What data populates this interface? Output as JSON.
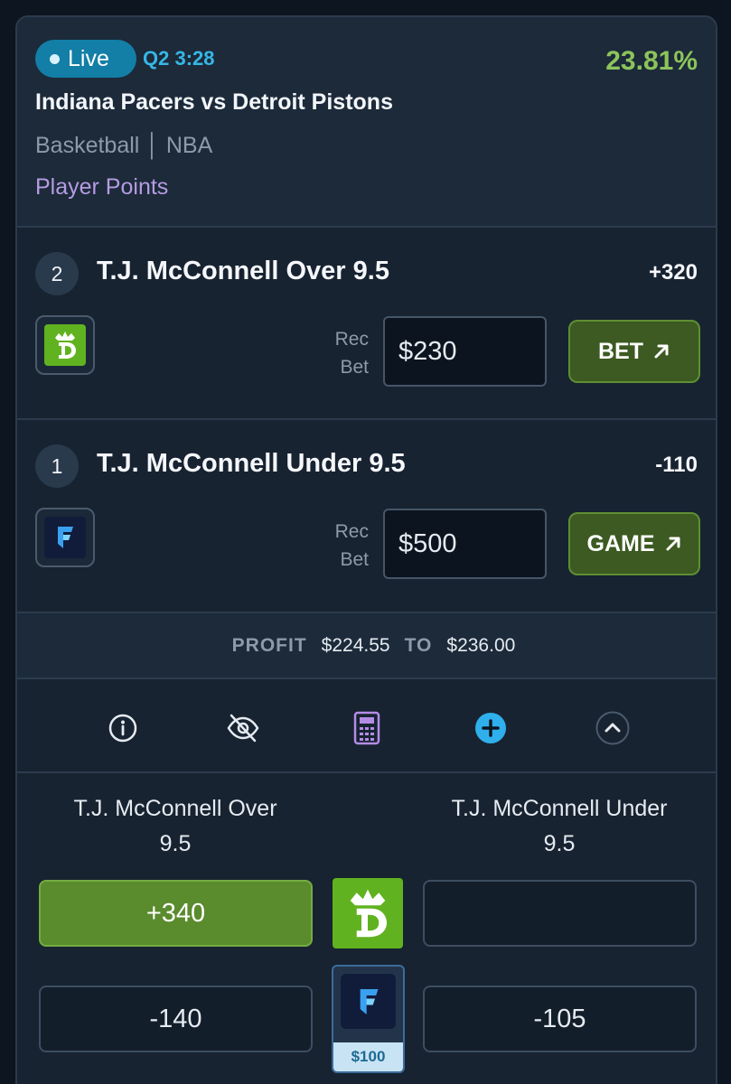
{
  "event": {
    "live_label": "Live",
    "clock": "Q2 3:28",
    "percentage": "23.81%",
    "matchup": "Indiana Pacers vs Detroit Pistons",
    "league": "Basketball │ NBA",
    "market": "Player Points"
  },
  "legs": [
    {
      "rank": "2",
      "selection": "T.J. McConnell Over 9.5",
      "odds": "+320",
      "book_icon": "draftkings-logo",
      "rec_label_1": "Rec",
      "rec_label_2": "Bet",
      "amount": "$230",
      "action_label": "BET"
    },
    {
      "rank": "1",
      "selection": "T.J. McConnell Under 9.5",
      "odds": "-110",
      "book_icon": "fanduel-logo",
      "rec_label_1": "Rec",
      "rec_label_2": "Bet",
      "amount": "$500",
      "action_label": "GAME"
    }
  ],
  "profit": {
    "label": "PROFIT",
    "low": "$224.55",
    "to_label": "TO",
    "high": "$236.00"
  },
  "toolbar": {
    "icons": [
      "info-icon",
      "hide-eye-icon",
      "calculator-icon",
      "add-icon",
      "collapse-chevron-icon"
    ],
    "colors": {
      "calculator": "#b48ce6",
      "add": "#2fb0ec"
    }
  },
  "comparison": {
    "over": {
      "title_line1": "T.J. McConnell Over",
      "title_line2": "9.5",
      "rows": [
        "+340",
        "-140"
      ]
    },
    "under": {
      "title_line1": "T.J. McConnell Under",
      "title_line2": "9.5",
      "rows": [
        "",
        "-105"
      ]
    },
    "books": [
      "draftkings-logo",
      "fanduel-logo"
    ],
    "stake_tag": "$100"
  },
  "colors": {
    "background": "#0d1521",
    "accent_green": "#8cc45a",
    "live_blue": "#137ea6",
    "market_purple": "#b69be2",
    "bet_button": "#3c5a21",
    "best_odds": "#5a8b2d"
  }
}
